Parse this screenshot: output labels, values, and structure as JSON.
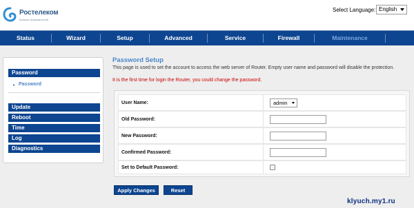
{
  "header": {
    "logo_name": "Ростелеком",
    "logo_tagline": "Больше возможностей",
    "language_label": "Select Language:",
    "language_value": "English"
  },
  "nav": {
    "items": [
      {
        "label": "Status"
      },
      {
        "label": "Wizard"
      },
      {
        "label": "Setup"
      },
      {
        "label": "Advanced"
      },
      {
        "label": "Service"
      },
      {
        "label": "Firewall"
      },
      {
        "label": "Maintenance",
        "active": true
      }
    ]
  },
  "sidebar": {
    "section_password": "Password",
    "sub_password": "Password",
    "sections": [
      "Update",
      "Reboot",
      "Time",
      "Log",
      "Diagnostics"
    ]
  },
  "main": {
    "title": "Password Setup",
    "description": "This page is used to set the account to access the web server of Router. Empty user name and password will disable the protection.",
    "warning": "It is the first time for login the Router, you could change the password.",
    "form": {
      "user_name_label": "User Name:",
      "user_name_value": "admin",
      "old_password_label": "Old Password:",
      "new_password_label": "New Password:",
      "confirmed_password_label": "Confirmed Password:",
      "default_password_label": "Set to Default Password:",
      "default_password_checked": false
    },
    "buttons": {
      "apply": "Apply Changes",
      "reset": "Reset"
    }
  },
  "watermark": "klyuch.my1.ru",
  "colors": {
    "nav_bg": "#0d4590",
    "accent_text": "#4a86c8",
    "warning_text": "#cc0000"
  }
}
